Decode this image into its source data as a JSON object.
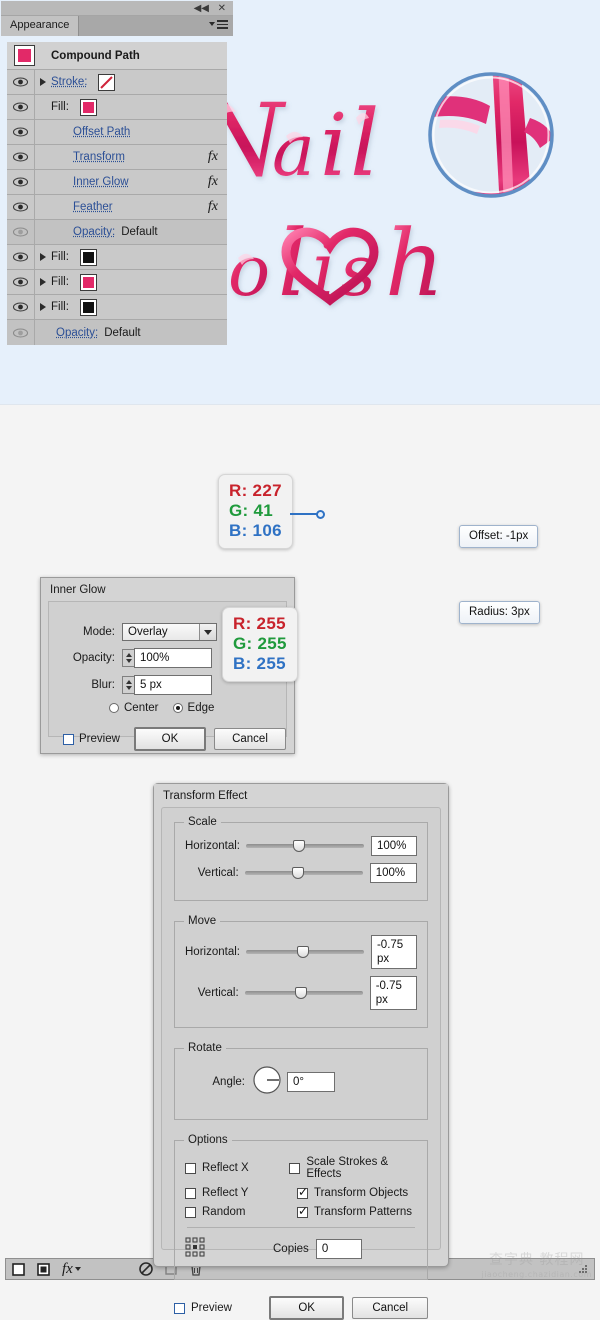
{
  "artwork": {
    "title_line1": "Nail",
    "title_line2": "Polish",
    "background_color": "#e6f0fb",
    "text_color": "#e22968",
    "magnifier_label": "magnifier-circle"
  },
  "callouts": {
    "fill_color": {
      "r": "R: 227",
      "g": "G: 41",
      "b": "B: 106"
    },
    "glow_color": {
      "r": "R: 255",
      "g": "G: 255",
      "b": "B: 255"
    },
    "accent_color": "#2f72c4"
  },
  "inner_glow_dialog": {
    "title": "Inner Glow",
    "mode_label": "Mode:",
    "mode_value": "Overlay",
    "opacity_label": "Opacity:",
    "opacity_value": "100%",
    "blur_label": "Blur:",
    "blur_value": "5 px",
    "center_label": "Center",
    "edge_label": "Edge",
    "preview_label": "Preview",
    "ok_label": "OK",
    "cancel_label": "Cancel",
    "swatch_color": "#ffffff"
  },
  "appearance_panel": {
    "tab_label": "Appearance",
    "collapse_icon": "collapse-icon",
    "close_icon": "close-icon",
    "menu_icon": "panel-menu-icon",
    "header": {
      "label": "Compound Path",
      "swatch_color": "#e22968"
    },
    "rows": [
      {
        "label": "Stroke:",
        "kind": "link",
        "eye": true,
        "arrow": true,
        "swatch": "none",
        "fx": false
      },
      {
        "label": "Fill:",
        "kind": "plain",
        "eye": true,
        "arrow": false,
        "swatch": "#e22968",
        "fx": false
      },
      {
        "label": "Offset Path",
        "kind": "link",
        "eye": true,
        "arrow": false,
        "swatch": null,
        "fx": false
      },
      {
        "label": "Transform",
        "kind": "link",
        "eye": true,
        "arrow": false,
        "swatch": null,
        "fx": true
      },
      {
        "label": "Inner Glow",
        "kind": "link",
        "eye": true,
        "arrow": false,
        "swatch": null,
        "fx": true
      },
      {
        "label": "Feather",
        "kind": "link",
        "eye": true,
        "arrow": false,
        "swatch": null,
        "fx": true
      },
      {
        "label": "Opacity:",
        "value": "Default",
        "kind": "opacity",
        "eye": false,
        "arrow": false,
        "swatch": null,
        "fx": false
      },
      {
        "label": "Fill:",
        "kind": "plain",
        "eye": true,
        "arrow": true,
        "swatch": "#111111",
        "fx": false
      },
      {
        "label": "Fill:",
        "kind": "plain",
        "eye": true,
        "arrow": true,
        "swatch": "#e22968",
        "fx": false
      },
      {
        "label": "Fill:",
        "kind": "plain",
        "eye": true,
        "arrow": true,
        "swatch": "#111111",
        "fx": false
      },
      {
        "label": "Opacity:",
        "value": "Default",
        "kind": "opacity",
        "eye": false,
        "arrow": false,
        "swatch": null,
        "fx": false
      }
    ],
    "footer_icons": [
      "new-fill-icon",
      "new-stroke-icon",
      "add-effect-fx-icon",
      "clear-appearance-icon",
      "duplicate-item-icon",
      "delete-item-icon",
      "resize-grip-icon"
    ],
    "tooltips": {
      "offset": "Offset: -1px",
      "radius": "Radius: 3px"
    }
  },
  "transform_dialog": {
    "title": "Transform Effect",
    "scale": {
      "legend": "Scale",
      "horizontal_label": "Horizontal:",
      "horizontal_value": "100%",
      "vertical_label": "Vertical:",
      "vertical_value": "100%",
      "horizontal_pct": 45,
      "vertical_pct": 45
    },
    "move": {
      "legend": "Move",
      "horizontal_label": "Horizontal:",
      "horizontal_value": "-0.75 px",
      "vertical_label": "Vertical:",
      "vertical_value": "-0.75 px",
      "horizontal_pct": 48,
      "vertical_pct": 48
    },
    "rotate": {
      "legend": "Rotate",
      "angle_label": "Angle:",
      "angle_value": "0°"
    },
    "options": {
      "legend": "Options",
      "reflect_x": {
        "label": "Reflect X",
        "checked": false
      },
      "reflect_y": {
        "label": "Reflect Y",
        "checked": false
      },
      "random": {
        "label": "Random",
        "checked": false
      },
      "scale_strokes": {
        "label": "Scale Strokes & Effects",
        "checked": false
      },
      "transform_objects": {
        "label": "Transform Objects",
        "checked": true
      },
      "transform_patterns": {
        "label": "Transform Patterns",
        "checked": true
      },
      "copies_label": "Copies",
      "copies_value": "0"
    },
    "preview_label": "Preview",
    "ok_label": "OK",
    "cancel_label": "Cancel"
  },
  "watermark": {
    "main": "查字典 教程网",
    "sub": "jiaocheng.chazidian.com"
  }
}
